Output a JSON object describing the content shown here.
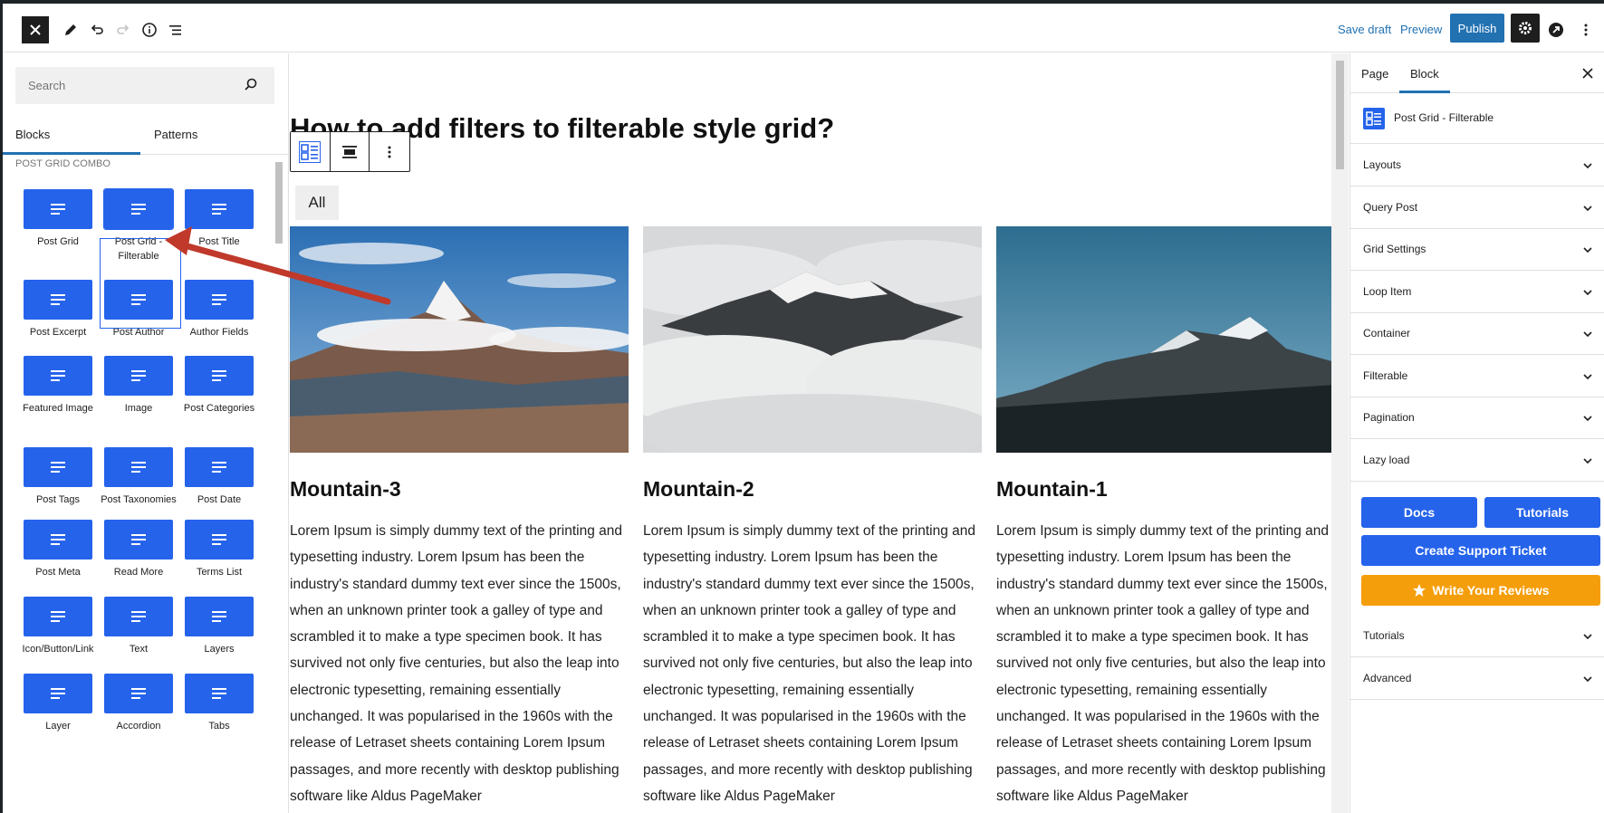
{
  "toolbar": {
    "close_icon": "close-icon",
    "save_draft": "Save draft",
    "preview": "Preview",
    "publish": "Publish"
  },
  "inserter": {
    "search_placeholder": "Search",
    "tabs": [
      "Blocks",
      "Patterns"
    ],
    "category": "POST GRID COMBO",
    "blocks": [
      {
        "label": "Post Grid",
        "icon": "grid-icon"
      },
      {
        "label": "Post Grid - Filterable",
        "icon": "grid-filter-icon"
      },
      {
        "label": "Post Title",
        "icon": "title-icon"
      },
      {
        "label": "Post Excerpt",
        "icon": "excerpt-icon"
      },
      {
        "label": "Post Author",
        "icon": "author-icon"
      },
      {
        "label": "Author Fields",
        "icon": "author-fields-icon"
      },
      {
        "label": "Featured Image",
        "icon": "image-icon"
      },
      {
        "label": "Image",
        "icon": "image-icon"
      },
      {
        "label": "Post Categories",
        "icon": "categories-icon"
      },
      {
        "label": "Post Tags",
        "icon": "tags-icon"
      },
      {
        "label": "Post Taxonomies",
        "icon": "taxonomies-icon"
      },
      {
        "label": "Post Date",
        "icon": "date-icon"
      },
      {
        "label": "Post Meta",
        "icon": "meta-icon"
      },
      {
        "label": "Read More",
        "icon": "read-more-icon"
      },
      {
        "label": "Terms List",
        "icon": "terms-icon"
      },
      {
        "label": "Icon/Button/Link",
        "icon": "shapes-icon"
      },
      {
        "label": "Text",
        "icon": "text-icon"
      },
      {
        "label": "Layers",
        "icon": "layers-icon"
      },
      {
        "label": "Layer",
        "icon": "layer-icon"
      },
      {
        "label": "Accordion",
        "icon": "accordion-icon"
      },
      {
        "label": "Tabs",
        "icon": "tabs-icon"
      }
    ]
  },
  "canvas": {
    "title": "How to add filters to filterable style grid?",
    "filter_all": "All",
    "cards": [
      {
        "title": "Mountain-3",
        "text": "Lorem Ipsum is simply dummy text of the printing and typesetting industry. Lorem Ipsum has been the industry's standard dummy text ever since the 1500s, when an unknown printer took a galley of type and scrambled it to make a type specimen book. It has survived not only five centuries, but also the leap into electronic typesetting, remaining essentially unchanged. It was popularised in the 1960s with the release of Letraset sheets containing Lorem Ipsum passages, and more recently with desktop publishing software like Aldus PageMaker"
      },
      {
        "title": "Mountain-2",
        "text": "Lorem Ipsum is simply dummy text of the printing and typesetting industry. Lorem Ipsum has been the industry's standard dummy text ever since the 1500s, when an unknown printer took a galley of type and scrambled it to make a type specimen book. It has survived not only five centuries, but also the leap into electronic typesetting, remaining essentially unchanged. It was popularised in the 1960s with the release of Letraset sheets containing Lorem Ipsum passages, and more recently with desktop publishing software like Aldus PageMaker"
      },
      {
        "title": "Mountain-1",
        "text": "Lorem Ipsum is simply dummy text of the printing and typesetting industry. Lorem Ipsum has been the industry's standard dummy text ever since the 1500s, when an unknown printer took a galley of type and scrambled it to make a type specimen book. It has survived not only five centuries, but also the leap into electronic typesetting, remaining essentially unchanged. It was popularised in the 1960s with the release of Letraset sheets containing Lorem Ipsum passages, and more recently with desktop publishing software like Aldus PageMaker"
      }
    ]
  },
  "settings": {
    "tabs": [
      "Page",
      "Block"
    ],
    "block_name": "Post Grid - Filterable",
    "panels": [
      "Layouts",
      "Query Post",
      "Grid Settings",
      "Loop Item",
      "Container",
      "Filterable",
      "Pagination",
      "Lazy load"
    ],
    "docs": "Docs",
    "tutorials_btn": "Tutorials",
    "support": "Create Support Ticket",
    "reviews": "Write Your Reviews",
    "panels_bottom": [
      "Tutorials",
      "Advanced"
    ]
  },
  "colors": {
    "accent": "#2271b1",
    "block_blue": "#2563eb",
    "orange": "#f59e0b",
    "annotation_red": "#c0392b"
  }
}
